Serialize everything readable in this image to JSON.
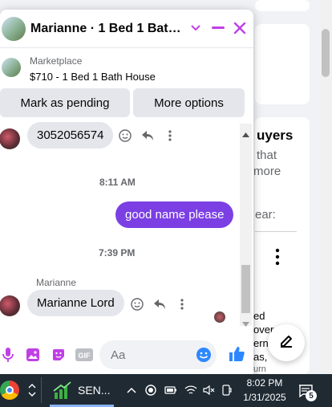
{
  "background": {
    "heading": "uyers",
    "line1": "that",
    "line2": "more",
    "line3": "ear:",
    "frag1": "ed",
    "frag2": "over",
    "frag3": "ern",
    "frag4": "as,",
    "frag5": "urn"
  },
  "chat": {
    "title": "Marianne · 1 Bed 1 Bath H...",
    "listing_label": "Marketplace",
    "listing_title": "$710 - 1 Bed 1 Bath House",
    "mark_pending_label": "Mark as pending",
    "more_options_label": "More options",
    "messages": [
      {
        "text": "3052056574"
      },
      {
        "timestamp": "8:11 AM"
      },
      {
        "text": "good name please"
      },
      {
        "timestamp": "7:39 PM"
      },
      {
        "sender": "Marianne",
        "text": "Marianne Lord"
      }
    ],
    "composer": {
      "placeholder": "Aa"
    },
    "accent_color": "#c03fe6",
    "bubble_color": "#7b3fe4"
  },
  "taskbar": {
    "app_label": "SEN...",
    "time": "8:02 PM",
    "date": "1/31/2025",
    "notification_count": "5"
  }
}
